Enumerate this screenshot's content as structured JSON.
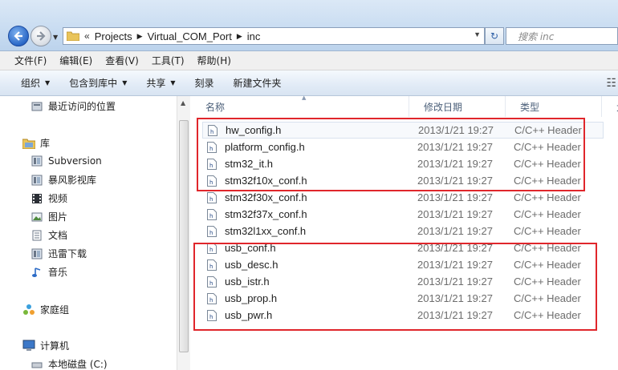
{
  "address": {
    "chevron": "«",
    "crumbs": [
      "Projects",
      "Virtual_COM_Port",
      "inc"
    ],
    "search_placeholder": "搜索 inc"
  },
  "menu": [
    "文件(F)",
    "编辑(E)",
    "查看(V)",
    "工具(T)",
    "帮助(H)"
  ],
  "commands": [
    {
      "label": "组织",
      "dropdown": true
    },
    {
      "label": "包含到库中",
      "dropdown": true
    },
    {
      "label": "共享",
      "dropdown": true
    },
    {
      "label": "刻录",
      "dropdown": false
    },
    {
      "label": "新建文件夹",
      "dropdown": false
    }
  ],
  "nav": [
    {
      "label": "最近访问的位置",
      "icon": "recent-places-icon"
    },
    {
      "label": "库",
      "icon": "libraries-icon"
    },
    {
      "label": "Subversion",
      "icon": "library-folder-icon"
    },
    {
      "label": "暴风影视库",
      "icon": "library-folder-icon"
    },
    {
      "label": "视频",
      "icon": "video-library-icon"
    },
    {
      "label": "图片",
      "icon": "pictures-library-icon"
    },
    {
      "label": "文档",
      "icon": "documents-library-icon"
    },
    {
      "label": "迅雷下载",
      "icon": "library-folder-icon"
    },
    {
      "label": "音乐",
      "icon": "music-library-icon"
    },
    {
      "label": "家庭组",
      "icon": "homegroup-icon"
    },
    {
      "label": "计算机",
      "icon": "computer-icon"
    },
    {
      "label": "本地磁盘 (C:)",
      "icon": "drive-icon"
    }
  ],
  "columns": {
    "name": "名称",
    "date": "修改日期",
    "type": "类型",
    "size": "大"
  },
  "files": [
    {
      "name": "hw_config.h",
      "date": "2013/1/21 19:27",
      "type": "C/C++ Header"
    },
    {
      "name": "platform_config.h",
      "date": "2013/1/21 19:27",
      "type": "C/C++ Header"
    },
    {
      "name": "stm32_it.h",
      "date": "2013/1/21 19:27",
      "type": "C/C++ Header"
    },
    {
      "name": "stm32f10x_conf.h",
      "date": "2013/1/21 19:27",
      "type": "C/C++ Header"
    },
    {
      "name": "stm32f30x_conf.h",
      "date": "2013/1/21 19:27",
      "type": "C/C++ Header"
    },
    {
      "name": "stm32f37x_conf.h",
      "date": "2013/1/21 19:27",
      "type": "C/C++ Header"
    },
    {
      "name": "stm32l1xx_conf.h",
      "date": "2013/1/21 19:27",
      "type": "C/C++ Header"
    },
    {
      "name": "usb_conf.h",
      "date": "2013/1/21 19:27",
      "type": "C/C++ Header"
    },
    {
      "name": "usb_desc.h",
      "date": "2013/1/21 19:27",
      "type": "C/C++ Header"
    },
    {
      "name": "usb_istr.h",
      "date": "2013/1/21 19:27",
      "type": "C/C++ Header"
    },
    {
      "name": "usb_prop.h",
      "date": "2013/1/21 19:27",
      "type": "C/C++ Header"
    },
    {
      "name": "usb_pwr.h",
      "date": "2013/1/21 19:27",
      "type": "C/C++ Header"
    }
  ],
  "colors": {
    "highlight": "#e0262b",
    "column_text": "#4c607a"
  }
}
